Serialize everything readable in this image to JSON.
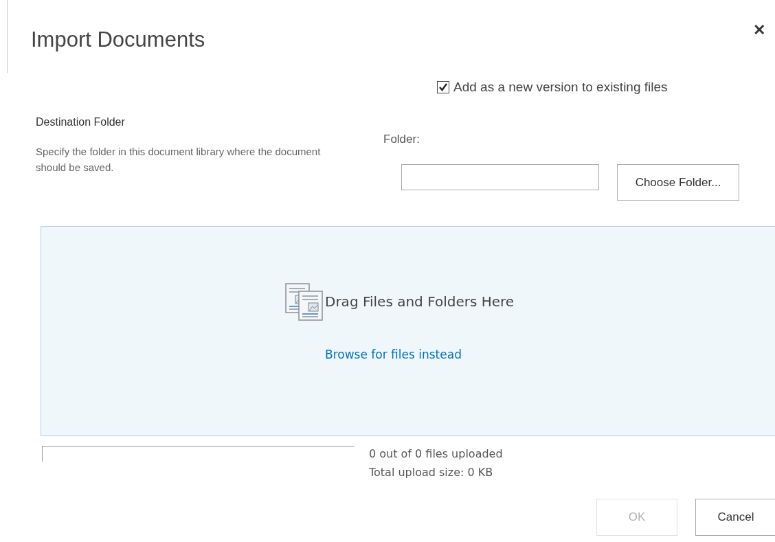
{
  "dialog": {
    "title": "Import Documents",
    "close": "✕"
  },
  "version_option": {
    "label": "Add as a new version to existing files",
    "checked": true
  },
  "destination": {
    "heading": "Destination Folder",
    "description": "Specify the folder in this document library where the document should be saved.",
    "folder_label": "Folder:",
    "choose_button": "Choose Folder..."
  },
  "drop_zone": {
    "text": "Drag Files and Folders Here",
    "link": "Browse for files instead"
  },
  "upload": {
    "level": 0,
    "files_status": "0 out of 0 files uploaded",
    "size_status": "Total upload size: 0 KB"
  },
  "buttons": [
    {
      "label": "OK",
      "disabled": true
    },
    {
      "label": "Cancel",
      "disabled": false
    }
  ]
}
